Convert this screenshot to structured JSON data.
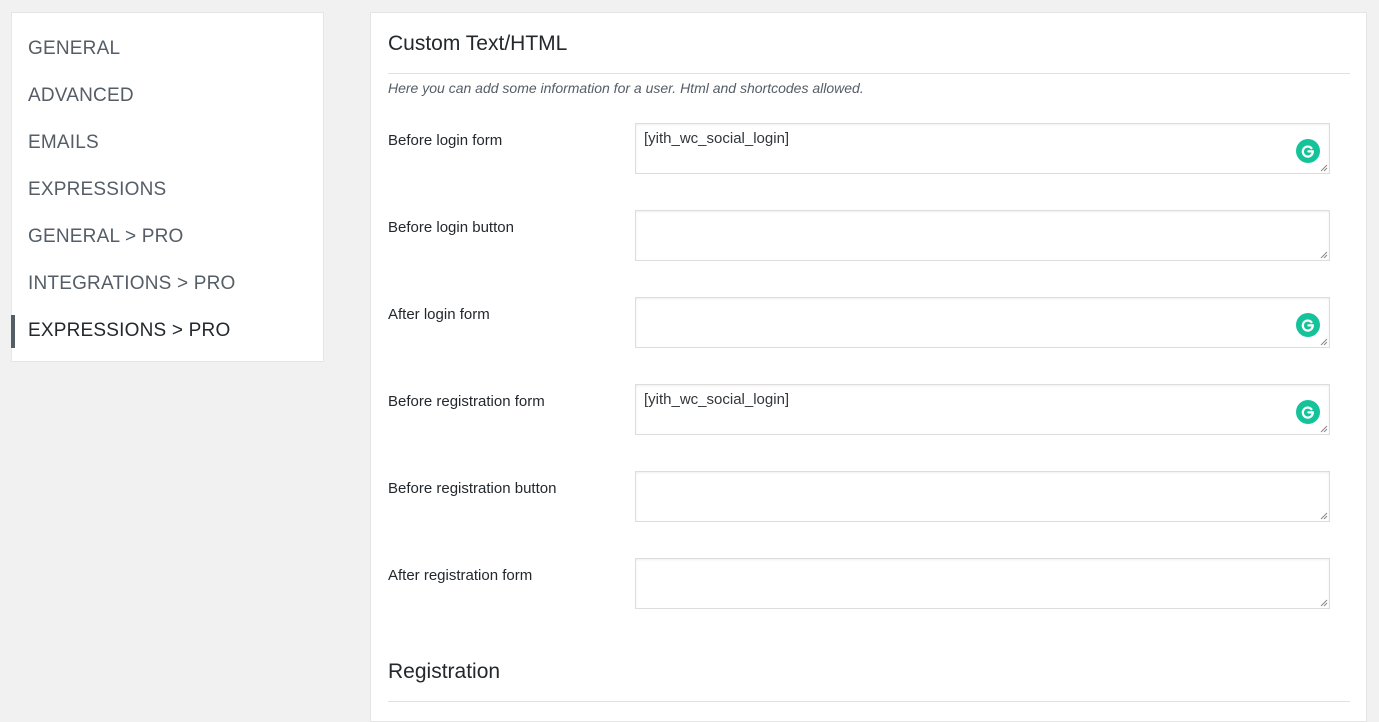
{
  "sidebar": {
    "items": [
      {
        "label": "GENERAL"
      },
      {
        "label": "ADVANCED"
      },
      {
        "label": "EMAILS"
      },
      {
        "label": "EXPRESSIONS"
      },
      {
        "label": "GENERAL > PRO"
      },
      {
        "label": "INTEGRATIONS > PRO"
      },
      {
        "label": "EXPRESSIONS > PRO",
        "active": true
      }
    ]
  },
  "section": {
    "title": "Custom Text/HTML",
    "description": "Here you can add some information for a user. Html and shortcodes allowed.",
    "fields": [
      {
        "label": "Before login form",
        "value": "[yith_wc_social_login]",
        "grammarly_icon": true
      },
      {
        "label": "Before login button",
        "value": "",
        "grammarly_icon": false
      },
      {
        "label": "After login form",
        "value": "",
        "grammarly_icon": true
      },
      {
        "label": "Before registration form",
        "value": "[yith_wc_social_login]",
        "grammarly_icon": true
      },
      {
        "label": "Before registration button",
        "value": "",
        "grammarly_icon": false
      },
      {
        "label": "After registration form",
        "value": "",
        "grammarly_icon": false
      }
    ]
  },
  "next_section": {
    "title": "Registration"
  },
  "colors": {
    "grammarly": "#15c39a",
    "active_indicator": "#555d66"
  },
  "icons": {
    "grammarly": "grammarly-icon",
    "resize": "resize-handle-icon"
  }
}
